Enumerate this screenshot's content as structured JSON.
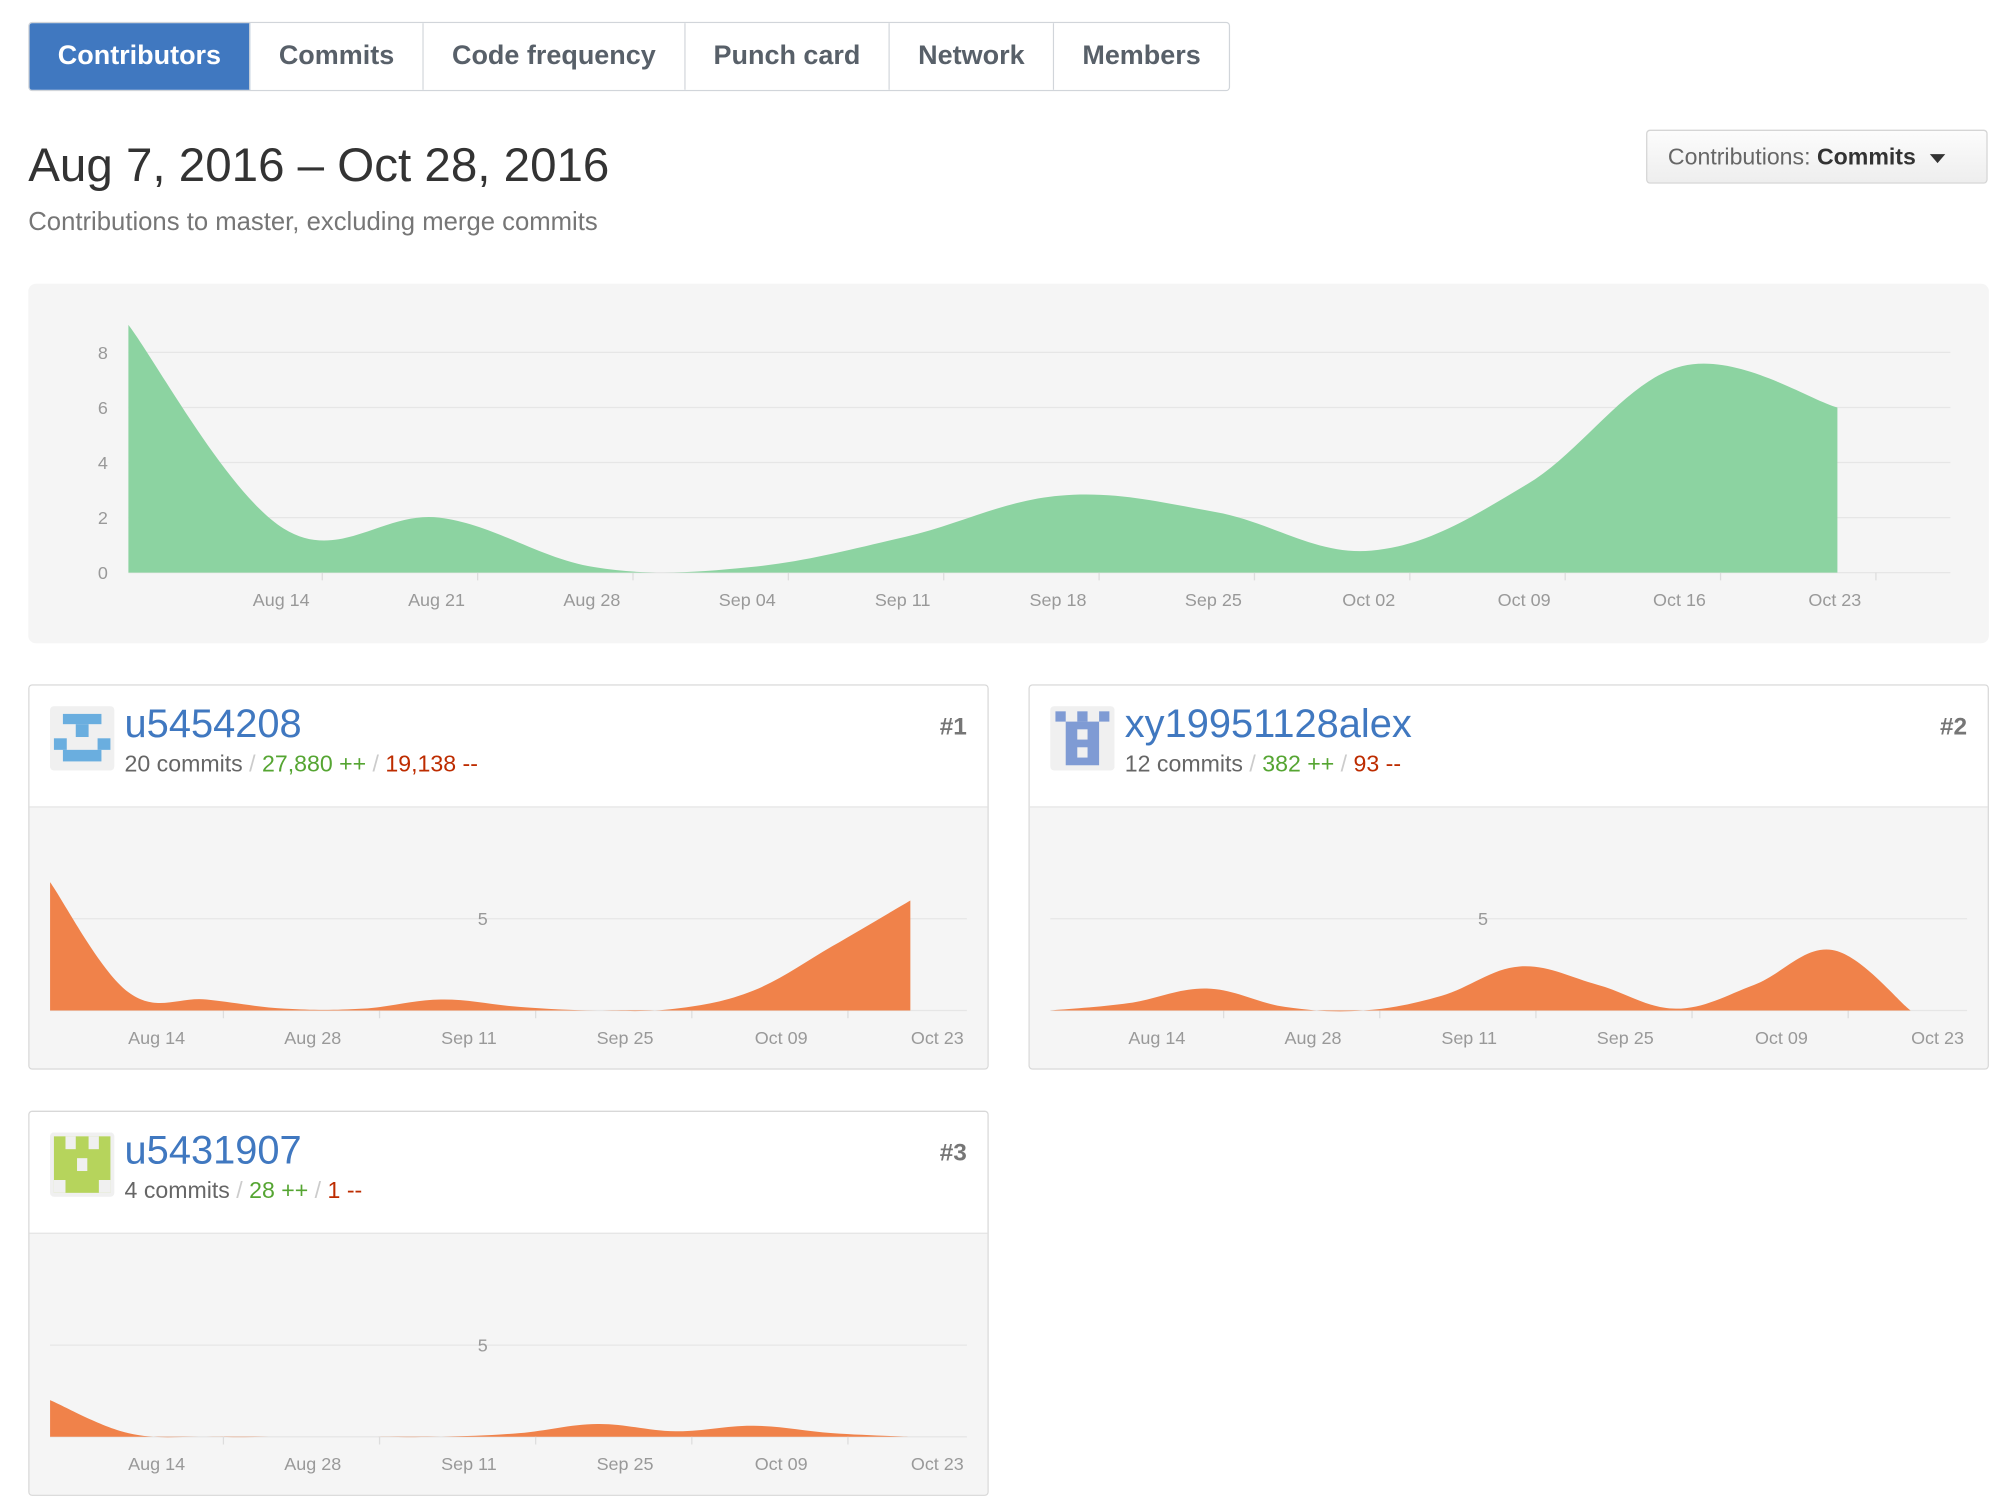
{
  "tabs": [
    {
      "label": "Contributors",
      "selected": true
    },
    {
      "label": "Commits",
      "selected": false
    },
    {
      "label": "Code frequency",
      "selected": false
    },
    {
      "label": "Punch card",
      "selected": false
    },
    {
      "label": "Network",
      "selected": false
    },
    {
      "label": "Members",
      "selected": false
    }
  ],
  "header": {
    "date_range": "Aug 7, 2016 – Oct 28, 2016",
    "subtitle": "Contributions to master, excluding merge commits"
  },
  "contributions_select": {
    "prefix": "Contributions:",
    "value": "Commits"
  },
  "colors": {
    "accent": "#4078c0",
    "commits_area": "#8cd3a1",
    "user_area": "#f0824a",
    "additions": "#55a532",
    "deletions": "#bd2c00"
  },
  "chart_data": [
    {
      "type": "area",
      "name": "all-contributors",
      "x": [
        "Aug 07",
        "Aug 14",
        "Aug 21",
        "Aug 28",
        "Sep 04",
        "Sep 11",
        "Sep 18",
        "Sep 25",
        "Oct 02",
        "Oct 09",
        "Oct 16",
        "Oct 23"
      ],
      "values": [
        9,
        1.6,
        2,
        0.2,
        0.2,
        1.3,
        2.8,
        2.2,
        0.8,
        3.2,
        7.5,
        6
      ],
      "x_tick_labels": [
        "Aug 14",
        "Aug 21",
        "Aug 28",
        "Sep 04",
        "Sep 11",
        "Sep 18",
        "Sep 25",
        "Oct 02",
        "Oct 09",
        "Oct 16",
        "Oct 23"
      ],
      "y_tick_labels": [
        "0",
        "2",
        "4",
        "6",
        "8"
      ],
      "ylim": [
        0,
        9
      ],
      "grid": true,
      "color": "#8cd3a1"
    }
  ],
  "contributors": [
    {
      "username": "u5454208",
      "rank": "#1",
      "commits": "20 commits",
      "additions": "27,880 ++",
      "deletions": "19,138 --",
      "avatar": "identicon-blue",
      "chart": {
        "type": "area",
        "ylim": [
          0,
          7
        ],
        "y_tick_label": "5",
        "x": [
          "Aug 07",
          "Aug 14",
          "Aug 21",
          "Aug 28",
          "Sep 04",
          "Sep 11",
          "Sep 18",
          "Sep 25",
          "Oct 02",
          "Oct 09",
          "Oct 16",
          "Oct 23"
        ],
        "values": [
          7,
          1,
          0.6,
          0.1,
          0.1,
          0.6,
          0.2,
          0,
          0.1,
          1.1,
          3.5,
          6
        ],
        "x_tick_labels": [
          "Aug 14",
          "Aug 28",
          "Sep 11",
          "Sep 25",
          "Oct 09",
          "Oct 23"
        ]
      }
    },
    {
      "username": "xy19951128alex",
      "rank": "#2",
      "commits": "12 commits",
      "additions": "382 ++",
      "deletions": "93 --",
      "avatar": "identicon-purple",
      "chart": {
        "type": "area",
        "ylim": [
          0,
          7
        ],
        "y_tick_label": "5",
        "x": [
          "Aug 07",
          "Aug 14",
          "Aug 21",
          "Aug 28",
          "Sep 04",
          "Sep 11",
          "Sep 18",
          "Sep 25",
          "Oct 02",
          "Oct 09",
          "Oct 16",
          "Oct 23"
        ],
        "values": [
          0,
          0.4,
          1.2,
          0.2,
          0,
          0.8,
          2.4,
          1.4,
          0.1,
          1.4,
          3.3,
          0
        ],
        "x_tick_labels": [
          "Aug 14",
          "Aug 28",
          "Sep 11",
          "Sep 25",
          "Oct 09",
          "Oct 23"
        ]
      }
    },
    {
      "username": "u5431907",
      "rank": "#3",
      "commits": "4 commits",
      "additions": "28 ++",
      "deletions": "1 --",
      "avatar": "identicon-green",
      "chart": {
        "type": "area",
        "ylim": [
          0,
          7
        ],
        "y_tick_label": "5",
        "x": [
          "Aug 07",
          "Aug 14",
          "Aug 21",
          "Aug 28",
          "Sep 04",
          "Sep 11",
          "Sep 18",
          "Sep 25",
          "Oct 02",
          "Oct 09",
          "Oct 16",
          "Oct 23"
        ],
        "values": [
          2,
          0.2,
          0,
          0,
          0,
          0,
          0.2,
          0.7,
          0.3,
          0.6,
          0.2,
          0
        ],
        "x_tick_labels": [
          "Aug 14",
          "Aug 28",
          "Sep 11",
          "Sep 25",
          "Oct 09",
          "Oct 23"
        ]
      }
    }
  ]
}
